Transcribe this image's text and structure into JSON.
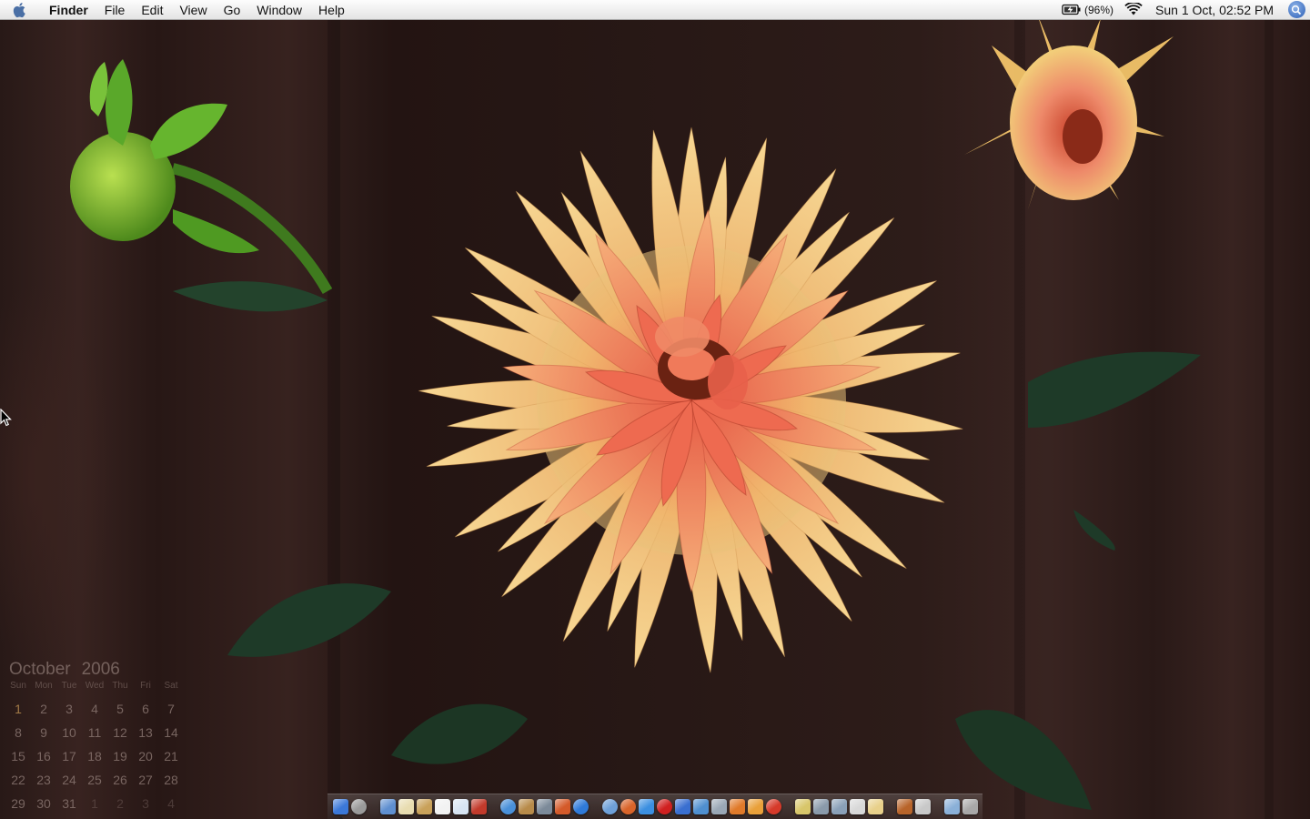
{
  "menubar": {
    "apple_icon": "apple-logo-icon",
    "app_name": "Finder",
    "menus": [
      "File",
      "Edit",
      "View",
      "Go",
      "Window",
      "Help"
    ],
    "battery_percent": "(96%)",
    "battery_icon": "battery-charging-icon",
    "wifi_icon": "wifi-icon",
    "clock": "Sun 1 Oct, 02:52 PM",
    "spotlight_icon": "spotlight-search-icon"
  },
  "calendar": {
    "month": "October",
    "year": "2006",
    "weekdays": [
      "Sun",
      "Mon",
      "Tue",
      "Wed",
      "Thu",
      "Fri",
      "Sat"
    ],
    "weeks": [
      [
        "1",
        "2",
        "3",
        "4",
        "5",
        "6",
        "7"
      ],
      [
        "8",
        "9",
        "10",
        "11",
        "12",
        "13",
        "14"
      ],
      [
        "15",
        "16",
        "17",
        "18",
        "19",
        "20",
        "21"
      ],
      [
        "22",
        "23",
        "24",
        "25",
        "26",
        "27",
        "28"
      ],
      [
        "29",
        "30",
        "31",
        "1",
        "2",
        "3",
        "4"
      ]
    ],
    "today": "1"
  },
  "dock": {
    "groups": [
      [
        {
          "name": "finder-icon",
          "color": "#3b78d8",
          "running": true
        },
        {
          "name": "dashboard-icon",
          "color": "#9a9a9a",
          "round": true
        }
      ],
      [
        {
          "name": "preview-icon",
          "color": "#5f8fd0"
        },
        {
          "name": "textedit-icon",
          "color": "#e8dcb0"
        },
        {
          "name": "iphoto-icon",
          "color": "#c9a15a"
        },
        {
          "name": "ical-icon",
          "color": "#f2f2f2"
        },
        {
          "name": "info-icon",
          "color": "#d8e4f2"
        },
        {
          "name": "acrobat-icon",
          "color": "#c23a2b"
        }
      ],
      [
        {
          "name": "safari-compass-icon",
          "color": "#4a90d9",
          "round": true
        },
        {
          "name": "script-editor-icon",
          "color": "#b88b4a"
        },
        {
          "name": "image-capture-icon",
          "color": "#7c8a99"
        },
        {
          "name": "photo-booth-icon",
          "color": "#d45a2a"
        },
        {
          "name": "quicktime-icon",
          "color": "#2f7ad9",
          "round": true
        }
      ],
      [
        {
          "name": "network-globe-icon",
          "color": "#6ea0d8",
          "round": true
        },
        {
          "name": "firefox-icon",
          "color": "#d9642a",
          "round": true
        },
        {
          "name": "internet-explorer-icon",
          "color": "#3c8fe0"
        },
        {
          "name": "opera-icon",
          "color": "#d02020",
          "round": true
        },
        {
          "name": "msn-messenger-icon",
          "color": "#3a6fd0"
        },
        {
          "name": "mail-icon",
          "color": "#4f8fcf"
        },
        {
          "name": "xcode-icon",
          "color": "#9aa8b6"
        },
        {
          "name": "flash-icon",
          "color": "#e07a2a"
        },
        {
          "name": "photoshop-icon",
          "color": "#e9a03a"
        },
        {
          "name": "pdf-icon",
          "color": "#d63a2a",
          "round": true
        }
      ],
      [
        {
          "name": "starburst-icon",
          "color": "#d8c66a"
        },
        {
          "name": "system-preferences-icon",
          "color": "#8a9aaa"
        },
        {
          "name": "utilities-icon",
          "color": "#8aa0b8"
        },
        {
          "name": "address-book-icon",
          "color": "#d8d8d8"
        },
        {
          "name": "letter-icon",
          "color": "#e8d08a"
        }
      ],
      [
        {
          "name": "tools-icon",
          "color": "#b8642a"
        },
        {
          "name": "disk-utility-icon",
          "color": "#c8c8c8"
        }
      ],
      [
        {
          "name": "documents-folder-icon",
          "color": "#8ab0d8"
        },
        {
          "name": "trash-icon",
          "color": "#a8a8a8"
        }
      ]
    ]
  }
}
